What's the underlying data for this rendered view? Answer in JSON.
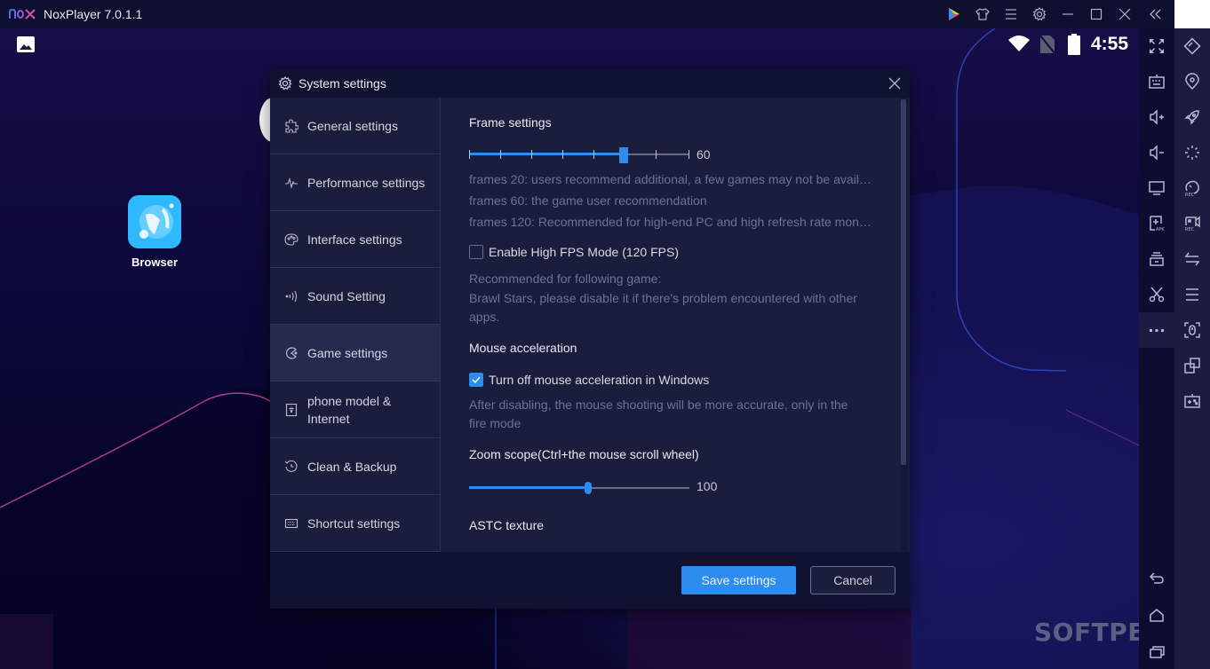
{
  "window": {
    "title": "NoxPlayer 7.0.1.1",
    "titlebar_icons": [
      "play-store-icon",
      "theme-shirt-icon",
      "menu-icon",
      "settings-gear-icon",
      "minimize-icon",
      "maximize-icon",
      "close-icon",
      "collapse-sidebar-icon"
    ]
  },
  "android": {
    "status_time": "4:55",
    "status_icons": [
      "wifi-icon",
      "no-sim-icon",
      "battery-icon"
    ],
    "apps": [
      {
        "label": "Browser"
      }
    ],
    "watermark": "SOFTPEDIA"
  },
  "sidebar": {
    "left_column": [
      "fullscreen-icon",
      "keyboard-icon",
      "volume-up-icon",
      "volume-down-icon",
      "screen-icon",
      "add-apk-icon",
      "toolbox-icon",
      "scissors-icon",
      "more-icon"
    ],
    "right_column": [
      "rotate-icon",
      "location-icon",
      "rocket-icon",
      "loading-icon",
      "macro-record-icon",
      "video-record-icon",
      "sync-icon",
      "menu-lines-icon",
      "screenshot-icon",
      "multi-instance-icon",
      "gamepad-icon"
    ],
    "bottom": [
      "back-icon",
      "home-icon",
      "recents-icon"
    ]
  },
  "dialog": {
    "title": "System settings",
    "nav": [
      {
        "label": "General settings",
        "icon": "puzzle-icon"
      },
      {
        "label": "Performance settings",
        "icon": "pulse-icon"
      },
      {
        "label": "Interface settings",
        "icon": "palette-icon"
      },
      {
        "label": "Sound Setting",
        "icon": "sound-icon"
      },
      {
        "label": "Game settings",
        "icon": "game-icon",
        "active": true
      },
      {
        "label": "phone model & Internet",
        "icon": "phone-wifi-icon"
      },
      {
        "label": "Clean & Backup",
        "icon": "history-icon"
      },
      {
        "label": "Shortcut settings",
        "icon": "keyboard-icon"
      }
    ],
    "content": {
      "frame": {
        "title": "Frame settings",
        "value": "60",
        "fraction": 0.7,
        "hints": [
          "frames 20: users recommend additional, a few games may not be available",
          "frames 60: the game user recommendation",
          "frames 120: Recommended for high-end PC and high refresh rate monitor"
        ]
      },
      "high_fps": {
        "label": "Enable High FPS Mode (120 FPS)",
        "checked": false,
        "hint1": "Recommended for following game:",
        "hint2": "Brawl Stars, please disable it if there's problem encountered with other apps."
      },
      "mouse": {
        "title": "Mouse acceleration",
        "label": "Turn off mouse acceleration in Windows",
        "checked": true,
        "hint": "After disabling, the mouse shooting will be more accurate, only in the fire mode"
      },
      "zoom": {
        "title": "Zoom scope(Ctrl+the mouse scroll wheel)",
        "value": "100",
        "fraction": 0.54
      },
      "astc": {
        "title": "ASTC texture"
      }
    },
    "buttons": {
      "save": "Save settings",
      "cancel": "Cancel"
    }
  }
}
